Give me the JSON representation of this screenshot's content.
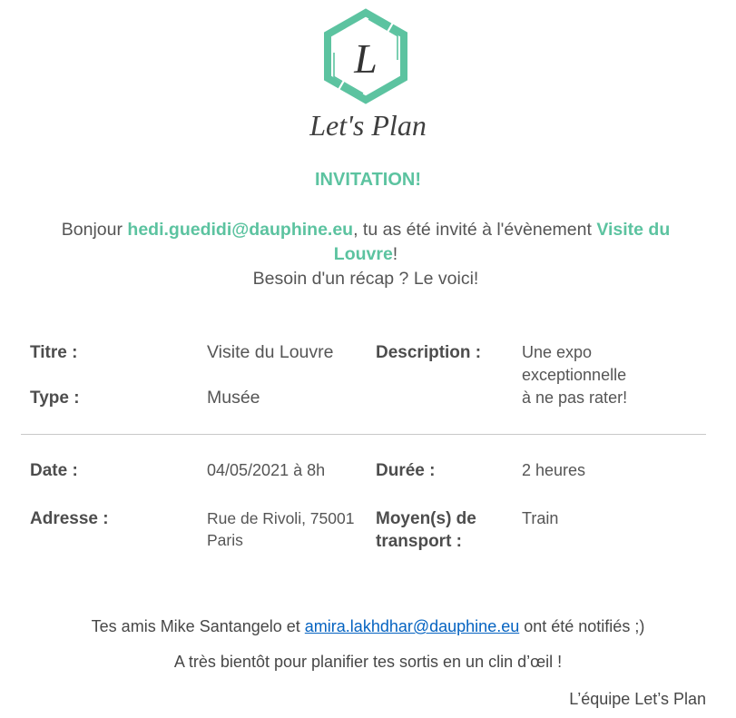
{
  "logo": {
    "monogram": "L",
    "brand": "Let's Plan"
  },
  "heading": "INVITATION!",
  "intro": {
    "greeting": "Bonjour ",
    "recipient_email": "hedi.guedidi@dauphine.eu",
    "middle": ", tu as été invité à l'évènement ",
    "event_name": "Visite du Louvre",
    "end": "!",
    "recap": "Besoin d'un récap ? Le voici!"
  },
  "details": {
    "title_label": "Titre :",
    "title_value": "Visite du Louvre",
    "type_label": "Type :",
    "type_value": "Musée",
    "description_label": "Description :",
    "description_value": "Une expo exceptionnelle à ne pas rater!",
    "date_label": "Date :",
    "date_value": "04/05/2021 à 8h",
    "duration_label": "Durée :",
    "duration_value": "2 heures",
    "address_label": "Adresse :",
    "address_value": "Rue de Rivoli, 75001 Paris",
    "transport_label": "Moyen(s) de transport :",
    "transport_value": "Train"
  },
  "footer": {
    "friends_prefix": "Tes amis Mike Santangelo et ",
    "friend_email": "amira.lakhdhar@dauphine.eu",
    "friends_suffix": " ont été notifiés ;)",
    "closing": "A très bientôt pour planifier tes sortis en un clin d’œil !",
    "signature": "L’équipe Let’s Plan"
  },
  "colors": {
    "accent": "#5cc3a0",
    "link": "#0563c1",
    "text": "#555555"
  }
}
